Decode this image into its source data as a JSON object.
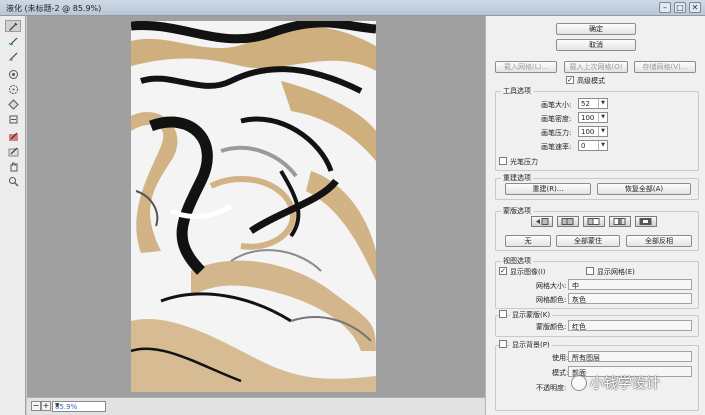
{
  "window": {
    "title": "液化 (未标题-2 @ 85.9%)",
    "controls": [
      "–",
      "□",
      "✕"
    ]
  },
  "tools": [
    {
      "name": "forward-warp-tool-icon"
    },
    {
      "name": "reconstruct-tool-icon"
    },
    {
      "name": "smooth-tool-icon"
    },
    {
      "name": "twirl-clockwise-tool-icon"
    },
    {
      "name": "pucker-tool-icon"
    },
    {
      "name": "bloat-tool-icon"
    },
    {
      "name": "push-left-tool-icon"
    },
    {
      "name": "freeze-mask-tool-icon"
    },
    {
      "name": "thaw-mask-tool-icon"
    },
    {
      "name": "hand-tool-icon"
    },
    {
      "name": "zoom-tool-icon"
    }
  ],
  "status": {
    "zoom_out": "−",
    "zoom_in": "+",
    "zoom_value": "85.9%"
  },
  "panel": {
    "ok": "确定",
    "cancel": "取消",
    "load_mesh": "载入网格(L)...",
    "load_last_mesh": "载入上次网格(O)",
    "save_mesh": "存储网格(V)...",
    "advanced_mode": "高级模式",
    "tool_options": {
      "title": "工具选项",
      "brush_size_label": "画笔大小:",
      "brush_size": "52",
      "brush_density_label": "画笔密度:",
      "brush_density": "100",
      "brush_pressure_label": "画笔压力:",
      "brush_pressure": "100",
      "brush_rate_label": "画笔速率:",
      "brush_rate": "0",
      "stylus_pressure": "光笔压力"
    },
    "reconstruct_options": {
      "title": "重建选项",
      "reconstruct": "重建(R)...",
      "restore_all": "恢复全部(A)"
    },
    "mask_options": {
      "title": "蒙版选项",
      "none": "无",
      "mask_all": "全部蒙住",
      "invert_all": "全部反相"
    },
    "view_options": {
      "title": "视图选项",
      "show_image": "显示图像(I)",
      "show_mesh": "显示网格(E)",
      "mesh_size_label": "网格大小:",
      "mesh_size": "中",
      "mesh_color_label": "网格颜色:",
      "mesh_color": "灰色"
    },
    "show_mask": {
      "label": "显示蒙版(K)",
      "mask_color_label": "蒙版颜色:",
      "mask_color": "红色"
    },
    "show_backdrop": {
      "label": "显示背景(P)",
      "use_label": "使用:",
      "use": "所有图层",
      "mode_label": "模式:",
      "mode": "前面",
      "opacity_label": "不透明度:"
    }
  },
  "watermark": {
    "text": "小钱学设计"
  },
  "colors": {
    "marble_gold": "#c9a26a",
    "marble_black": "#121212",
    "marble_white": "#f5f5f5",
    "canvas_bg": "#a0a0a0",
    "zoom_text": "#3a62c4"
  }
}
